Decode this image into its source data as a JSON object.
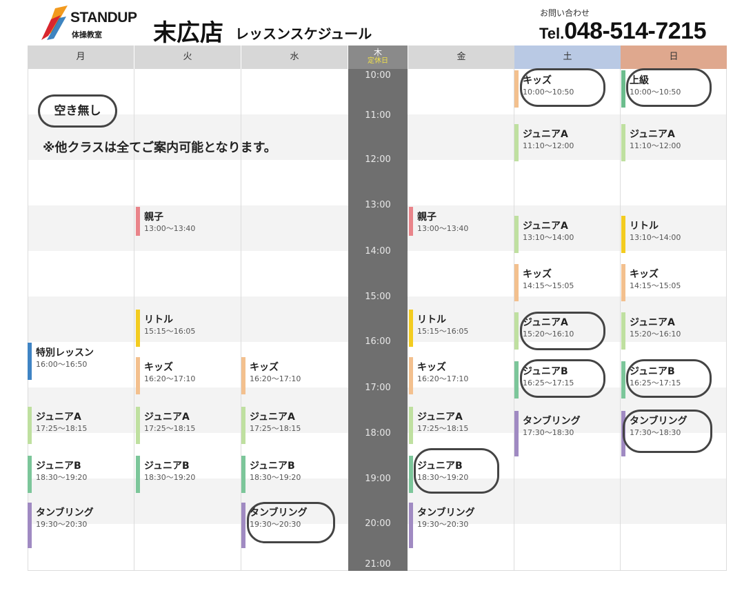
{
  "header": {
    "logo_main": "STANDUP",
    "logo_sub": "体操教室",
    "store_name": "末広店",
    "schedule_title": "レッスンスケジュール",
    "contact_label": "お問い合わせ",
    "tel_prefix": "Tel.",
    "tel_number": "048-514-7215"
  },
  "days": [
    "月",
    "火",
    "水",
    "木",
    "金",
    "土",
    "日"
  ],
  "thursday_closed": "定休日",
  "times": [
    "10:00",
    "11:00",
    "12:00",
    "13:00",
    "14:00",
    "15:00",
    "16:00",
    "17:00",
    "18:00",
    "19:00",
    "20:00",
    "21:00"
  ],
  "colors": {
    "saturday_header": "#b9c9e4",
    "sunday_header": "#dfa88e",
    "weekday_header": "#d7d7d7",
    "thursday_column": "#6f6f6f",
    "oyako": "#e9848a",
    "kids": "#f3c08e",
    "junior_a": "#bfe0a0",
    "junior_b": "#7cc69a",
    "tumbling": "#a08ac2",
    "little": "#f3cc20",
    "special": "#3f84c4",
    "advanced": "#6cbd8d"
  },
  "notices": {
    "full": "空き無し",
    "other_classes": "※他クラスは全てご案内可能となります。"
  },
  "lessons": {
    "mon": [
      {
        "name": "特別レッスン",
        "time": "16:00〜16:50",
        "color": "#3f84c4"
      },
      {
        "name": "ジュニアA",
        "time": "17:25〜18:15",
        "color": "#bfe0a0"
      },
      {
        "name": "ジュニアB",
        "time": "18:30〜19:20",
        "color": "#7cc69a"
      },
      {
        "name": "タンブリング",
        "time": "19:30〜20:30",
        "color": "#a08ac2"
      }
    ],
    "tue": [
      {
        "name": "親子",
        "time": "13:00〜13:40",
        "color": "#e9848a"
      },
      {
        "name": "リトル",
        "time": "15:15〜16:05",
        "color": "#f3cc20"
      },
      {
        "name": "キッズ",
        "time": "16:20〜17:10",
        "color": "#f3c08e"
      },
      {
        "name": "ジュニアA",
        "time": "17:25〜18:15",
        "color": "#bfe0a0"
      },
      {
        "name": "ジュニアB",
        "time": "18:30〜19:20",
        "color": "#7cc69a"
      }
    ],
    "wed": [
      {
        "name": "キッズ",
        "time": "16:20〜17:10",
        "color": "#f3c08e"
      },
      {
        "name": "ジュニアA",
        "time": "17:25〜18:15",
        "color": "#bfe0a0"
      },
      {
        "name": "ジュニアB",
        "time": "18:30〜19:20",
        "color": "#7cc69a"
      },
      {
        "name": "タンブリング",
        "time": "19:30〜20:30",
        "color": "#a08ac2"
      }
    ],
    "fri": [
      {
        "name": "親子",
        "time": "13:00〜13:40",
        "color": "#e9848a"
      },
      {
        "name": "リトル",
        "time": "15:15〜16:05",
        "color": "#f3cc20"
      },
      {
        "name": "キッズ",
        "time": "16:20〜17:10",
        "color": "#f3c08e"
      },
      {
        "name": "ジュニアA",
        "time": "17:25〜18:15",
        "color": "#bfe0a0"
      },
      {
        "name": "ジュニアB",
        "time": "18:30〜19:20",
        "color": "#7cc69a"
      },
      {
        "name": "タンブリング",
        "time": "19:30〜20:30",
        "color": "#a08ac2"
      }
    ],
    "sat": [
      {
        "name": "キッズ",
        "time": "10:00〜10:50",
        "color": "#f3c08e"
      },
      {
        "name": "ジュニアA",
        "time": "11:10〜12:00",
        "color": "#bfe0a0"
      },
      {
        "name": "ジュニアA",
        "time": "13:10〜14:00",
        "color": "#bfe0a0"
      },
      {
        "name": "キッズ",
        "time": "14:15〜15:05",
        "color": "#f3c08e"
      },
      {
        "name": "ジュニアA",
        "time": "15:20〜16:10",
        "color": "#bfe0a0"
      },
      {
        "name": "ジュニアB",
        "time": "16:25〜17:15",
        "color": "#7cc69a"
      },
      {
        "name": "タンブリング",
        "time": "17:30〜18:30",
        "color": "#a08ac2"
      }
    ],
    "sun": [
      {
        "name": "上級",
        "time": "10:00〜10:50",
        "color": "#6cbd8d"
      },
      {
        "name": "ジュニアA",
        "time": "11:10〜12:00",
        "color": "#bfe0a0"
      },
      {
        "name": "リトル",
        "time": "13:10〜14:00",
        "color": "#f3cc20"
      },
      {
        "name": "キッズ",
        "time": "14:15〜15:05",
        "color": "#f3c08e"
      },
      {
        "name": "ジュニアA",
        "time": "15:20〜16:10",
        "color": "#bfe0a0"
      },
      {
        "name": "ジュニアB",
        "time": "16:25〜17:15",
        "color": "#7cc69a"
      },
      {
        "name": "タンブリング",
        "time": "17:30〜18:30",
        "color": "#a08ac2"
      }
    ]
  }
}
